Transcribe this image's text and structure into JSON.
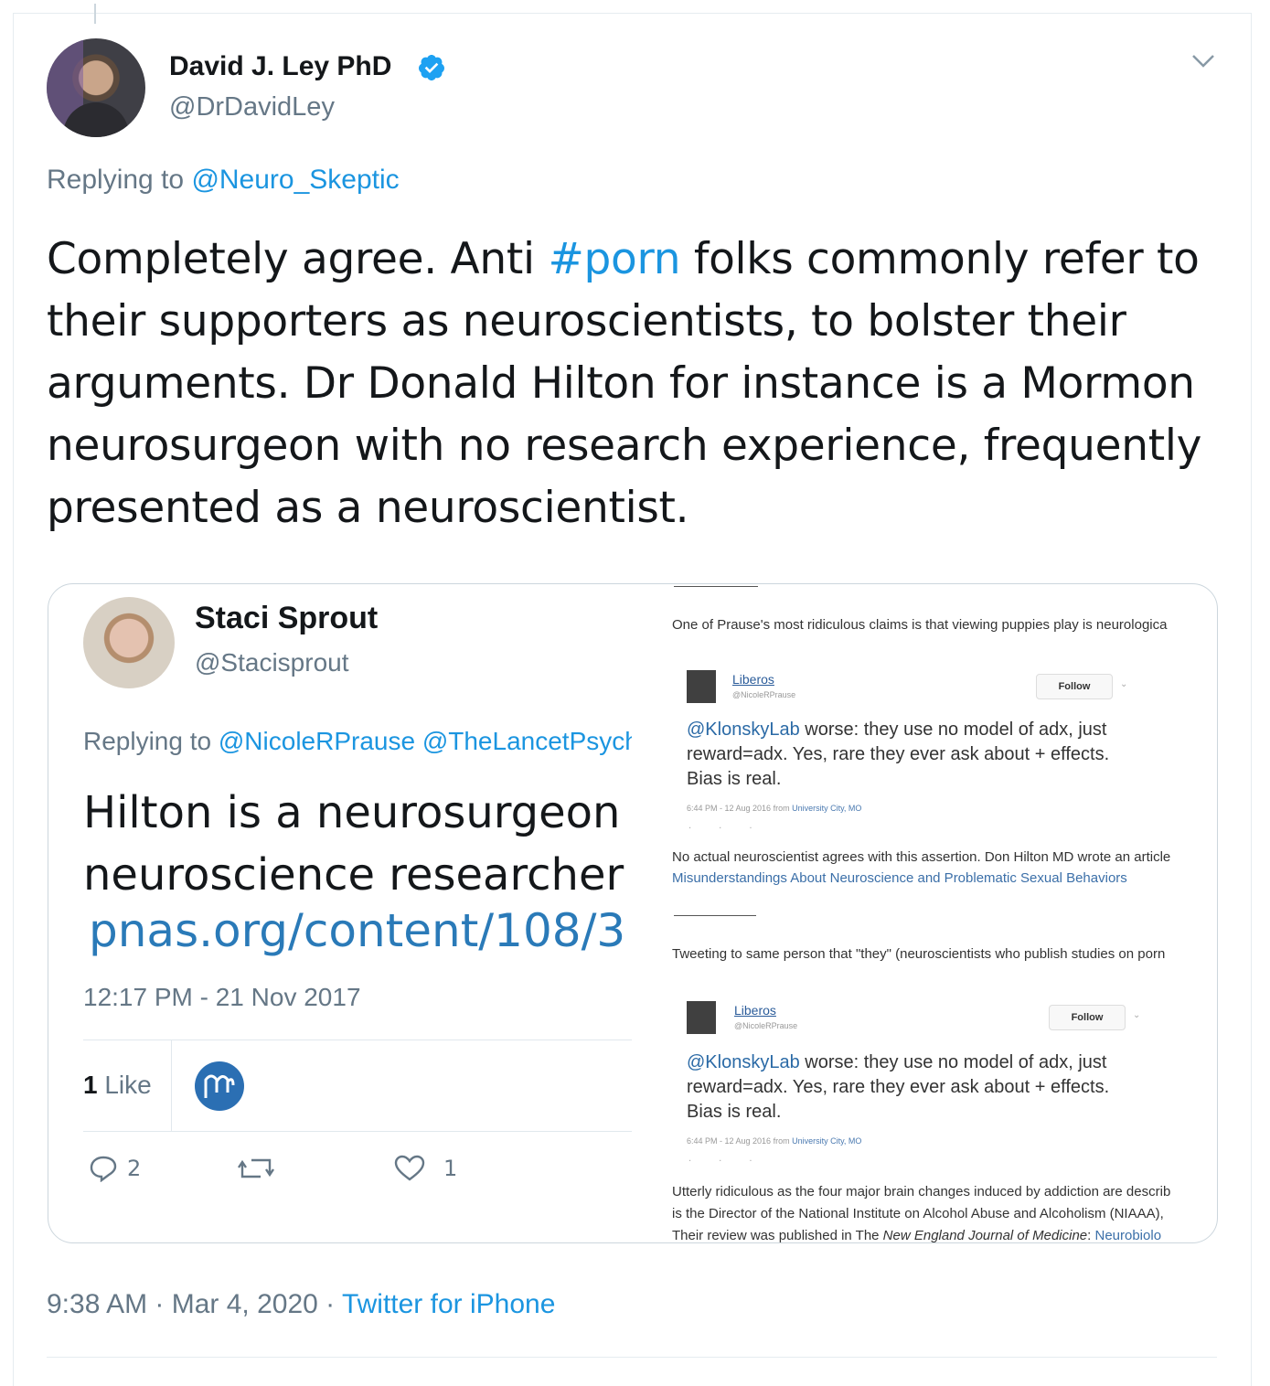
{
  "tweet": {
    "author_name": "David J. Ley PhD",
    "author_handle": "@DrDavidLey",
    "replying_prefix": "Replying to ",
    "replying_to": "@Neuro_Skeptic",
    "text_before_tag": "Completely agree. Anti ",
    "hashtag": "#porn",
    "text_after_tag": " folks commonly refer to their supporters as neuroscientists, to bolster their arguments. Dr Donald Hilton for instance is a Mormon neurosurgeon with no research experience, frequently presented as a neuroscientist.",
    "time": "9:38 AM · Mar 4, 2020 · ",
    "source": "Twitter for iPhone",
    "colors": {
      "link": "#1b95e0",
      "text": "#14171a",
      "muted": "#657786",
      "border": "#e6ecf0"
    }
  },
  "embed_left": {
    "author_name": "Staci Sprout",
    "author_handle": "@Stacisprout",
    "replying_prefix": "Replying to ",
    "replying_to": "@NicoleRPrause @TheLancetPsych",
    "line1": "Hilton is a neurosurgeon",
    "line2": "neuroscience researcher",
    "link": "pnas.org/content/108/3",
    "time": "12:17 PM - 21 Nov 2017",
    "likes_count": "1",
    "likes_label": " Like",
    "reply_count": "2",
    "like_count": "1"
  },
  "embed_right": {
    "p1": "One of Prause's most ridiculous claims is that viewing puppies play is neurologica",
    "card1": {
      "name": "Liberos",
      "handle": "@NicoleRPrause",
      "follow": "Follow",
      "mention": "@KlonskyLab",
      "text": " worse: they use no model of adx, just reward=adx. Yes, rare they ever ask about + effects. Bias is real.",
      "meta_time": "6:44 PM - 12 Aug 2016 from ",
      "meta_place": "University City, MO"
    },
    "p2": "No actual neuroscientist agrees with this assertion. Don Hilton MD wrote an article",
    "p2_link": "Misunderstandings About Neuroscience and Problematic Sexual Behaviors",
    "p3": "Tweeting to same person that \"they\" (neuroscientists who publish studies on porn",
    "card2": {
      "name": "Liberos",
      "handle": "@NicoleRPrause",
      "follow": "Follow",
      "mention": "@KlonskyLab",
      "text": " worse: they use no model of adx, just reward=adx. Yes, rare they ever ask about + effects. Bias is real.",
      "meta_time": "6:44 PM - 12 Aug 2016 from ",
      "meta_place": "University City, MO"
    },
    "p4_line1": "Utterly ridiculous as the four major brain changes induced by addiction are describ",
    "p4_line2": "is the Director of the National Institute on Alcohol Abuse and Alcoholism (NIAAA),",
    "p4_line3_a": "Their review was published in The ",
    "p4_line3_b": "New England Journal of Medicine",
    "p4_line3_c": ": ",
    "p4_line3_link": "Neurobiolo"
  }
}
